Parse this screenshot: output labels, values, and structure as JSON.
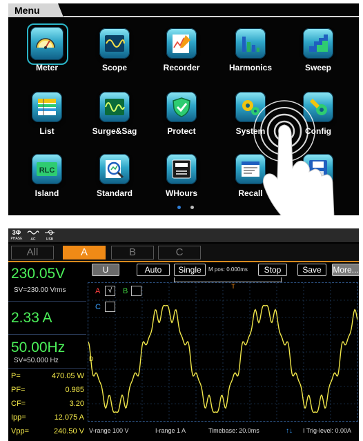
{
  "menu": {
    "title": "Menu",
    "apps": [
      {
        "label": "Meter",
        "icon": "meter-gauge-icon",
        "selected": true
      },
      {
        "label": "Scope",
        "icon": "scope-wave-icon",
        "selected": false
      },
      {
        "label": "Recorder",
        "icon": "recorder-chart-icon",
        "selected": false
      },
      {
        "label": "Harmonics",
        "icon": "harmonics-bars-icon",
        "selected": false
      },
      {
        "label": "Sweep",
        "icon": "sweep-steps-icon",
        "selected": false
      },
      {
        "label": "List",
        "icon": "list-table-icon",
        "selected": false
      },
      {
        "label": "Surge&Sag",
        "icon": "surge-sag-wave-icon",
        "selected": false
      },
      {
        "label": "Protect",
        "icon": "shield-check-icon",
        "selected": false
      },
      {
        "label": "System",
        "icon": "gears-icon",
        "selected": false
      },
      {
        "label": "Config",
        "icon": "wrench-gear-icon",
        "selected": false
      },
      {
        "label": "Island",
        "icon": "rlc-icon",
        "selected": false
      },
      {
        "label": "Standard",
        "icon": "magnifier-chart-icon",
        "selected": false
      },
      {
        "label": "WHours",
        "icon": "energy-meter-icon",
        "selected": false
      },
      {
        "label": "Recall",
        "icon": "recall-document-icon",
        "selected": false
      },
      {
        "label": "Save",
        "icon": "save-floppy-icon",
        "selected": false
      }
    ],
    "rlc_text": "RLC",
    "page_count": 2,
    "active_page": 1,
    "colors": {
      "tile_top": "#8fe7f5",
      "tile_bottom": "#0f5f86",
      "selection": "#2bb6c9",
      "dot_active": "#2f7fd8",
      "dot_inactive": "#bbbbbb"
    }
  },
  "scope": {
    "status_icons": [
      {
        "label": "3Φ",
        "sub": "PHASE",
        "icon": "three-phase-icon"
      },
      {
        "label": "AC",
        "sub": "AC",
        "icon": "ac-wave-icon"
      },
      {
        "label": "",
        "sub": "USB",
        "icon": "usb-icon"
      }
    ],
    "phase_tabs": [
      {
        "label": "All",
        "active": false
      },
      {
        "label": "A",
        "active": true
      },
      {
        "label": "B",
        "active": false
      },
      {
        "label": "C",
        "active": false
      }
    ],
    "readings": {
      "voltage": "230.05V",
      "voltage_sv": "SV=230.00 Vrms",
      "current": "2.33 A",
      "frequency": "50.00Hz",
      "frequency_sv": "SV=50.000  Hz"
    },
    "params": [
      {
        "key": "P=",
        "value": "470.05 W"
      },
      {
        "key": "PF=",
        "value": "0.985"
      },
      {
        "key": "CF=",
        "value": "3.20"
      },
      {
        "key": "Ipp=",
        "value": "12.075 A"
      },
      {
        "key": "Vpp=",
        "value": "240.50 V"
      }
    ],
    "toolbar": {
      "u_label": "U",
      "auto_label": "Auto",
      "single_label": "Single",
      "mpos_label": "M pos: 0.000ms",
      "stop_label": "Stop",
      "save_label": "Save",
      "more_label": "More..."
    },
    "channels": [
      {
        "letter": "A",
        "checked": true,
        "check_mark": "√",
        "color": "#ff4040"
      },
      {
        "letter": "B",
        "checked": false,
        "check_mark": "",
        "color": "#40d040"
      },
      {
        "letter": "C",
        "checked": false,
        "check_mark": "",
        "color": "#3aa0ff"
      }
    ],
    "trigger_marker": "T",
    "left_marker": "D",
    "bottom_info": {
      "vrange": "V-range  100 V",
      "irange": "I-range  1 A",
      "timebase": "Timebase:  20.0ms",
      "trig_arrows": "↑↓",
      "trig_level": "I Trig-level:  0.00A"
    },
    "waveform": {
      "cycles": 2.7,
      "color": "#f0e64a",
      "grid_color": "#2b4e7c"
    },
    "colors": {
      "readings_green": "#4cf25a",
      "params_yellow": "#f4e94a",
      "tab_active": "#f08a16"
    }
  }
}
